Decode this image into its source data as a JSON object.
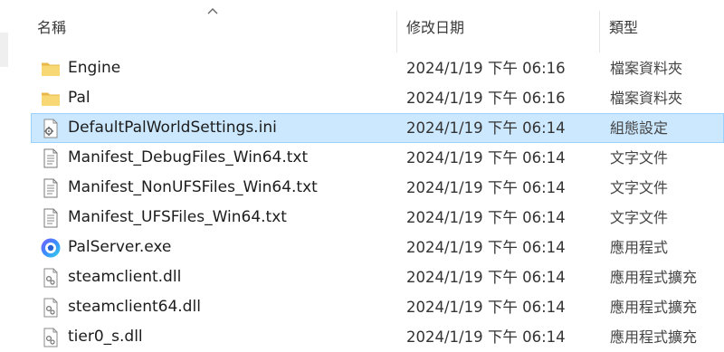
{
  "columns": {
    "name": "名稱",
    "date": "修改日期",
    "type": "類型"
  },
  "sort": {
    "column": "name",
    "direction": "ascending"
  },
  "files": [
    {
      "icon": "folder-icon",
      "name": "Engine",
      "date": "2024/1/19 下午 06:16",
      "type": "檔案資料夾"
    },
    {
      "icon": "folder-icon",
      "name": "Pal",
      "date": "2024/1/19 下午 06:16",
      "type": "檔案資料夾"
    },
    {
      "icon": "settings-file-icon",
      "name": "DefaultPalWorldSettings.ini",
      "date": "2024/1/19 下午 06:14",
      "type": "組態設定",
      "selected": true
    },
    {
      "icon": "text-file-icon",
      "name": "Manifest_DebugFiles_Win64.txt",
      "date": "2024/1/19 下午 06:14",
      "type": "文字文件"
    },
    {
      "icon": "text-file-icon",
      "name": "Manifest_NonUFSFiles_Win64.txt",
      "date": "2024/1/19 下午 06:14",
      "type": "文字文件"
    },
    {
      "icon": "text-file-icon",
      "name": "Manifest_UFSFiles_Win64.txt",
      "date": "2024/1/19 下午 06:14",
      "type": "文字文件"
    },
    {
      "icon": "exe-app-icon",
      "name": "PalServer.exe",
      "date": "2024/1/19 下午 06:14",
      "type": "應用程式"
    },
    {
      "icon": "dll-file-icon",
      "name": "steamclient.dll",
      "date": "2024/1/19 下午 06:14",
      "type": "應用程式擴充"
    },
    {
      "icon": "dll-file-icon",
      "name": "steamclient64.dll",
      "date": "2024/1/19 下午 06:14",
      "type": "應用程式擴充"
    },
    {
      "icon": "dll-file-icon",
      "name": "tier0_s.dll",
      "date": "2024/1/19 下午 06:14",
      "type": "應用程式擴充"
    }
  ],
  "colors": {
    "selection_bg": "#cce8ff",
    "selection_border": "#99d1ff",
    "folder": "#f8d775"
  }
}
